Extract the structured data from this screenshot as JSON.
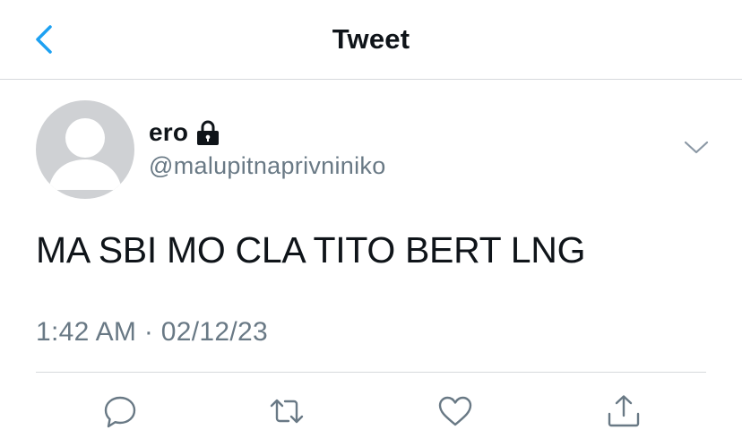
{
  "header": {
    "title": "Tweet",
    "back_icon": "chevron-left-icon"
  },
  "tweet": {
    "author_name": "ero",
    "protected_icon": "lock-icon",
    "author_handle": "@malupitnaprivniniko",
    "text": "MA SBI MO CLA TITO BERT LNG",
    "time": "1:42 AM",
    "separator": "·",
    "date": "02/12/23"
  },
  "actions": [
    {
      "icon": "reply-icon"
    },
    {
      "icon": "retweet-icon"
    },
    {
      "icon": "like-icon"
    },
    {
      "icon": "share-icon"
    }
  ],
  "colors": {
    "accent": "#1da1f2",
    "secondary_text": "#697985",
    "divider": "#d6d9dc",
    "avatar": "#cfd1d4"
  }
}
